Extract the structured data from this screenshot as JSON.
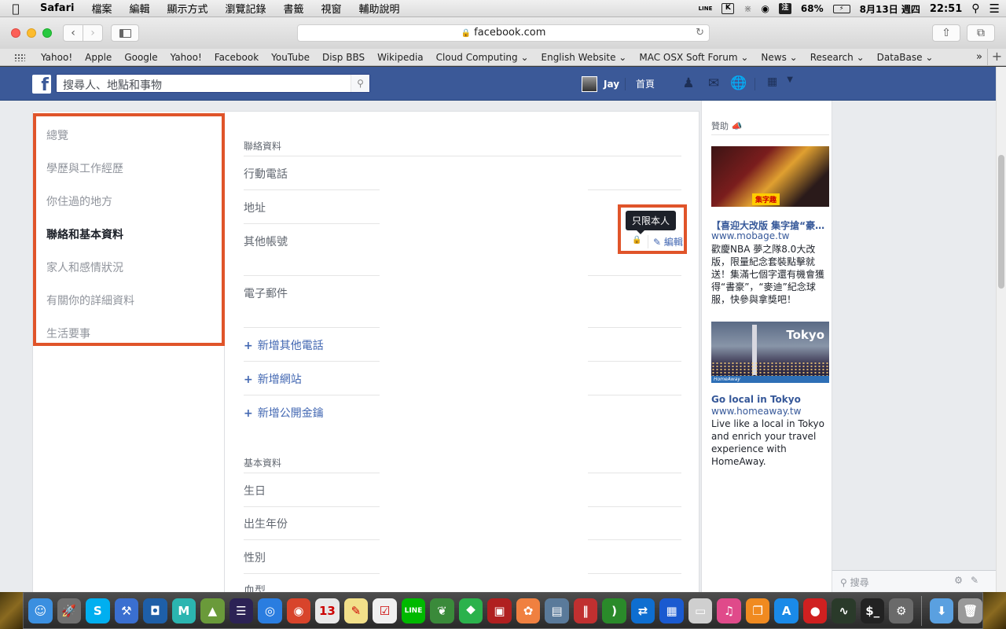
{
  "menubar": {
    "app": "Safari",
    "items": [
      "檔案",
      "編輯",
      "顯示方式",
      "瀏覽記錄",
      "書籤",
      "視窗",
      "輔助說明"
    ],
    "status": {
      "line_label": "LINE",
      "input_method": "注",
      "battery": "68%",
      "date": "8月13日 週四",
      "time": "22:51"
    }
  },
  "browser": {
    "url": "facebook.com",
    "bookmarks": [
      "Yahoo!",
      "Apple",
      "Google",
      "Yahoo!",
      "Facebook",
      "YouTube",
      "Disp BBS",
      "Wikipedia",
      "Cloud Computing ⌄",
      "English Website ⌄",
      "MAC OSX Soft Forum ⌄",
      "News ⌄",
      "Research ⌄",
      "DataBase ⌄"
    ],
    "more": "»",
    "plus": "+"
  },
  "fbbar": {
    "logo": "f",
    "search_placeholder": "搜尋人、地點和事物",
    "user_name": "Jay",
    "home_label": "首頁"
  },
  "leftnav": {
    "items": [
      {
        "label": "總覽",
        "active": false
      },
      {
        "label": "學歷與工作經歷",
        "active": false
      },
      {
        "label": "你住過的地方",
        "active": false
      },
      {
        "label": "聯絡和基本資料",
        "active": true
      },
      {
        "label": "家人和感情狀況",
        "active": false
      },
      {
        "label": "有關你的詳細資料",
        "active": false
      },
      {
        "label": "生活要事",
        "active": false
      }
    ]
  },
  "contact": {
    "heading": "聯絡資料",
    "fields": [
      "行動電話",
      "地址",
      "其他帳號",
      "電子郵件"
    ],
    "add_links": [
      "新增其他電話",
      "新增網站",
      "新增公開金鑰"
    ],
    "tooltip": "只限本人",
    "edit_label": "編輯"
  },
  "basic": {
    "heading": "基本資料",
    "fields": [
      "生日",
      "出生年份",
      "性別",
      "血型"
    ]
  },
  "ads": {
    "sponsored_label": "贊助",
    "ad1": {
      "image_badge": "集字趣",
      "title": "【喜迎大改版 集字搶“豪”送】",
      "domain": "www.mobage.tw",
      "body": "歡慶NBA 夢之隊8.0大改版，限量紀念套裝點擊就送！集滿七個字還有機會獲得“書豪”，“麥迪”紀念球服，快參與拿獎吧！"
    },
    "ad2": {
      "image_text": "Tokyo",
      "image_brand": "HomeAway",
      "title": "Go local in Tokyo",
      "domain": "www.homeaway.tw",
      "body": "Live like a local in Tokyo and enrich your travel experience with HomeAway."
    }
  },
  "chat": {
    "search_label": "搜尋"
  },
  "dock": {
    "apps": [
      {
        "name": "finder",
        "glyph": "☺",
        "color": "#3b8fe0"
      },
      {
        "name": "launchpad",
        "glyph": "🚀",
        "color": "#707070"
      },
      {
        "name": "skype",
        "glyph": "S",
        "color": "#00aff0"
      },
      {
        "name": "xcode",
        "glyph": "⚒",
        "color": "#3a6fd0"
      },
      {
        "name": "app",
        "glyph": "◘",
        "color": "#1e5fa8"
      },
      {
        "name": "mindnode",
        "glyph": "M",
        "color": "#2bb5b0"
      },
      {
        "name": "android-studio",
        "glyph": "▲",
        "color": "#6a9a3a"
      },
      {
        "name": "eclipse",
        "glyph": "☰",
        "color": "#2c2255"
      },
      {
        "name": "safari",
        "glyph": "◎",
        "color": "#2a7de0"
      },
      {
        "name": "chrome",
        "glyph": "◉",
        "color": "#d8442b"
      },
      {
        "name": "calendar",
        "glyph": "13",
        "color": "#e8e8e8"
      },
      {
        "name": "notes",
        "glyph": "✎",
        "color": "#f2e08a"
      },
      {
        "name": "reminders",
        "glyph": "☑",
        "color": "#f0f0f0"
      },
      {
        "name": "line",
        "glyph": "LINE",
        "color": "#00b900"
      },
      {
        "name": "evernote",
        "glyph": "❦",
        "color": "#3a8a3a"
      },
      {
        "name": "feedly",
        "glyph": "⯁",
        "color": "#2bb24c"
      },
      {
        "name": "photo-booth",
        "glyph": "▣",
        "color": "#b02020"
      },
      {
        "name": "photos",
        "glyph": "✿",
        "color": "#f08040"
      },
      {
        "name": "preview",
        "glyph": "▤",
        "color": "#5a7a9a"
      },
      {
        "name": "app",
        "glyph": "‖",
        "color": "#c03030"
      },
      {
        "name": "app",
        "glyph": ")",
        "color": "#2a8a2a"
      },
      {
        "name": "teamviewer",
        "glyph": "⇄",
        "color": "#0e6ed0"
      },
      {
        "name": "app",
        "glyph": "▦",
        "color": "#1a5ad0"
      },
      {
        "name": "app",
        "glyph": "▭",
        "color": "#cfcfcf"
      },
      {
        "name": "itunes",
        "glyph": "♫",
        "color": "#e04a8a"
      },
      {
        "name": "ibooks",
        "glyph": "❐",
        "color": "#f08a20"
      },
      {
        "name": "app-store",
        "glyph": "A",
        "color": "#1a8ae8"
      },
      {
        "name": "recorder",
        "glyph": "●",
        "color": "#d02020"
      },
      {
        "name": "activity-monitor",
        "glyph": "∿",
        "color": "#2a3a2a"
      },
      {
        "name": "terminal",
        "glyph": "$_",
        "color": "#222222"
      },
      {
        "name": "system-preferences",
        "glyph": "⚙",
        "color": "#6a6a6a"
      },
      {
        "name": "downloads",
        "glyph": "⬇",
        "color": "#5aa0e0"
      },
      {
        "name": "trash",
        "glyph": "🗑",
        "color": "#9a9a9a"
      }
    ]
  }
}
